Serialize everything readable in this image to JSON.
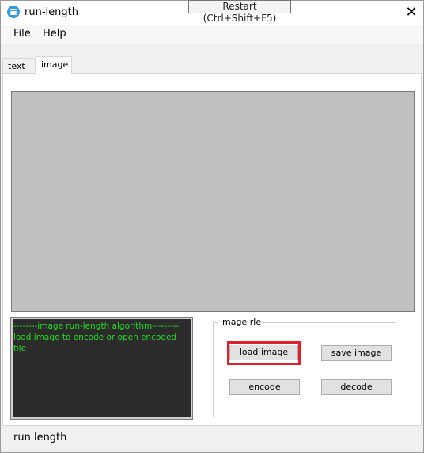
{
  "window": {
    "title": "run-length"
  },
  "tooltip": {
    "text": "Restart (Ctrl+Shift+F5)"
  },
  "menu": {
    "items": [
      {
        "label": "File"
      },
      {
        "label": "Help"
      }
    ]
  },
  "tabs": [
    {
      "label": "text"
    },
    {
      "label": "image"
    }
  ],
  "console": {
    "lines": [
      "--------image run-length algorithm---------",
      "load image to encode  or open encoded file"
    ]
  },
  "group": {
    "title": "image rle",
    "buttons": {
      "load": "load image",
      "save": "save image",
      "encode": "encode",
      "decode": "decode"
    }
  },
  "status": {
    "text": "run length"
  },
  "colors": {
    "console_bg": "#2b2b2b",
    "console_text": "#22dd22",
    "highlight": "#e0202a"
  }
}
